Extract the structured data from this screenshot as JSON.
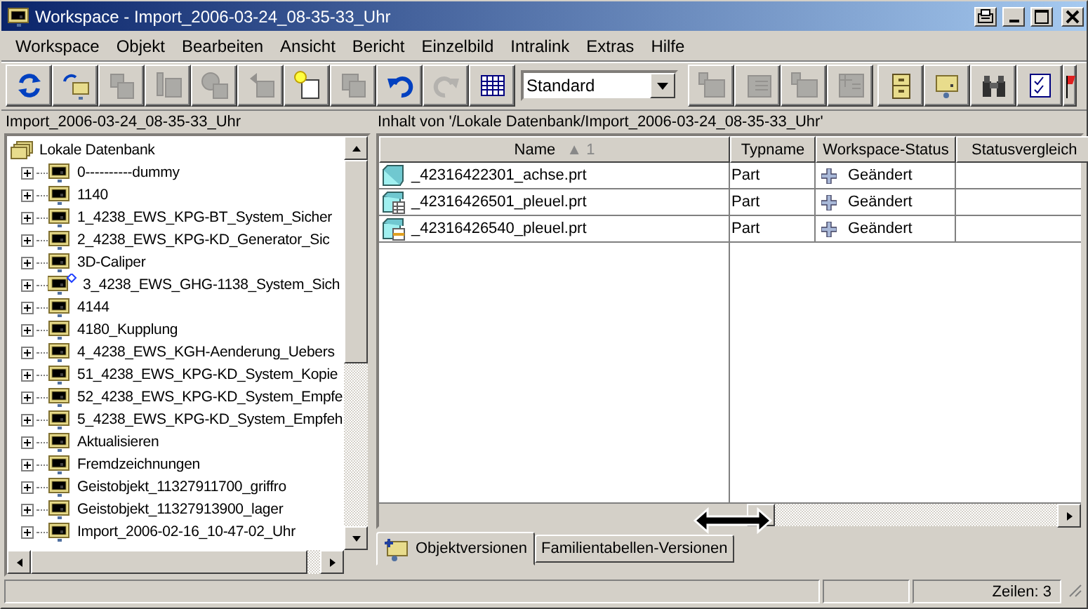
{
  "window": {
    "title": "Workspace - Import_2006-03-24_08-35-33_Uhr"
  },
  "menu": [
    "Workspace",
    "Objekt",
    "Bearbeiten",
    "Ansicht",
    "Bericht",
    "Einzelbild",
    "Intralink",
    "Extras",
    "Hilfe"
  ],
  "toolbar_left": [
    {
      "disabled": false
    },
    {
      "disabled": false
    },
    {
      "disabled": true
    },
    {
      "disabled": true
    },
    {
      "disabled": true
    },
    {
      "disabled": true
    },
    {
      "disabled": false
    },
    {
      "disabled": true
    },
    {
      "disabled": false
    },
    {
      "disabled": true
    },
    {
      "disabled": false
    }
  ],
  "view_select": {
    "value": "Standard"
  },
  "toolbar_right": [
    {
      "disabled": true
    },
    {
      "disabled": true
    },
    {
      "disabled": true
    },
    {
      "disabled": true
    },
    {
      "disabled": false
    },
    {
      "disabled": false
    },
    {
      "disabled": false
    },
    {
      "disabled": false
    },
    {
      "disabled": false
    }
  ],
  "tree": {
    "title": "Import_2006-03-24_08-35-33_Uhr",
    "root": "Lokale Datenbank",
    "children": [
      {
        "label": "0----------dummy",
        "kind": "folder",
        "expanded": false
      },
      {
        "label": "1140",
        "kind": "folder",
        "expanded": false
      },
      {
        "label": "1_4238_EWS_KPG-BT_System_Sicher",
        "kind": "folder",
        "expanded": false
      },
      {
        "label": "2_4238_EWS_KPG-KD_Generator_Sic",
        "kind": "folder",
        "expanded": false
      },
      {
        "label": "3D-Caliper",
        "kind": "folder",
        "expanded": false
      },
      {
        "label": "3_4238_EWS_GHG-1138_System_Sich",
        "kind": "marked",
        "expanded": false
      },
      {
        "label": "4144",
        "kind": "folder",
        "expanded": false
      },
      {
        "label": "4180_Kupplung",
        "kind": "folder",
        "expanded": false
      },
      {
        "label": "4_4238_EWS_KGH-Aenderung_Uebers",
        "kind": "folder",
        "expanded": false
      },
      {
        "label": "51_4238_EWS_KPG-KD_System_Kopie",
        "kind": "folder",
        "expanded": false
      },
      {
        "label": "52_4238_EWS_KPG-KD_System_Empfe",
        "kind": "folder",
        "expanded": false
      },
      {
        "label": "5_4238_EWS_KPG-KD_System_Empfeh",
        "kind": "folder",
        "expanded": false
      },
      {
        "label": "Aktualisieren",
        "kind": "folder",
        "expanded": false
      },
      {
        "label": "Fremdzeichnungen",
        "kind": "folder",
        "expanded": false
      },
      {
        "label": "Geistobjekt_11327911700_griffro",
        "kind": "folder",
        "expanded": false
      },
      {
        "label": "Geistobjekt_11327913900_lager",
        "kind": "folder",
        "expanded": false
      },
      {
        "label": "Import_2006-02-16_10-47-02_Uhr",
        "kind": "folder",
        "expanded": false
      }
    ]
  },
  "content": {
    "title": "Inhalt von '/Lokale Datenbank/Import_2006-03-24_08-35-33_Uhr'",
    "columns": [
      {
        "label": "Name",
        "sort": "▲ 1"
      },
      {
        "label": "Typname"
      },
      {
        "label": "Workspace-Status"
      },
      {
        "label": "Statusvergleich"
      }
    ],
    "rows": [
      {
        "kind": "part",
        "name": "_42316422301_achse.prt",
        "type": "Part",
        "status": "Geändert"
      },
      {
        "kind": "table",
        "name": "_42316426501_pleuel.prt",
        "type": "Part",
        "status": "Geändert"
      },
      {
        "kind": "instance",
        "name": "_42316426540_pleuel.prt",
        "type": "Part",
        "status": "Geändert"
      }
    ]
  },
  "tabs": [
    {
      "label": "Objektversionen",
      "selected": true
    },
    {
      "label": "Familientabellen-Versionen",
      "selected": false
    }
  ],
  "status_bar": {
    "rows": "Zeilen: 3"
  }
}
